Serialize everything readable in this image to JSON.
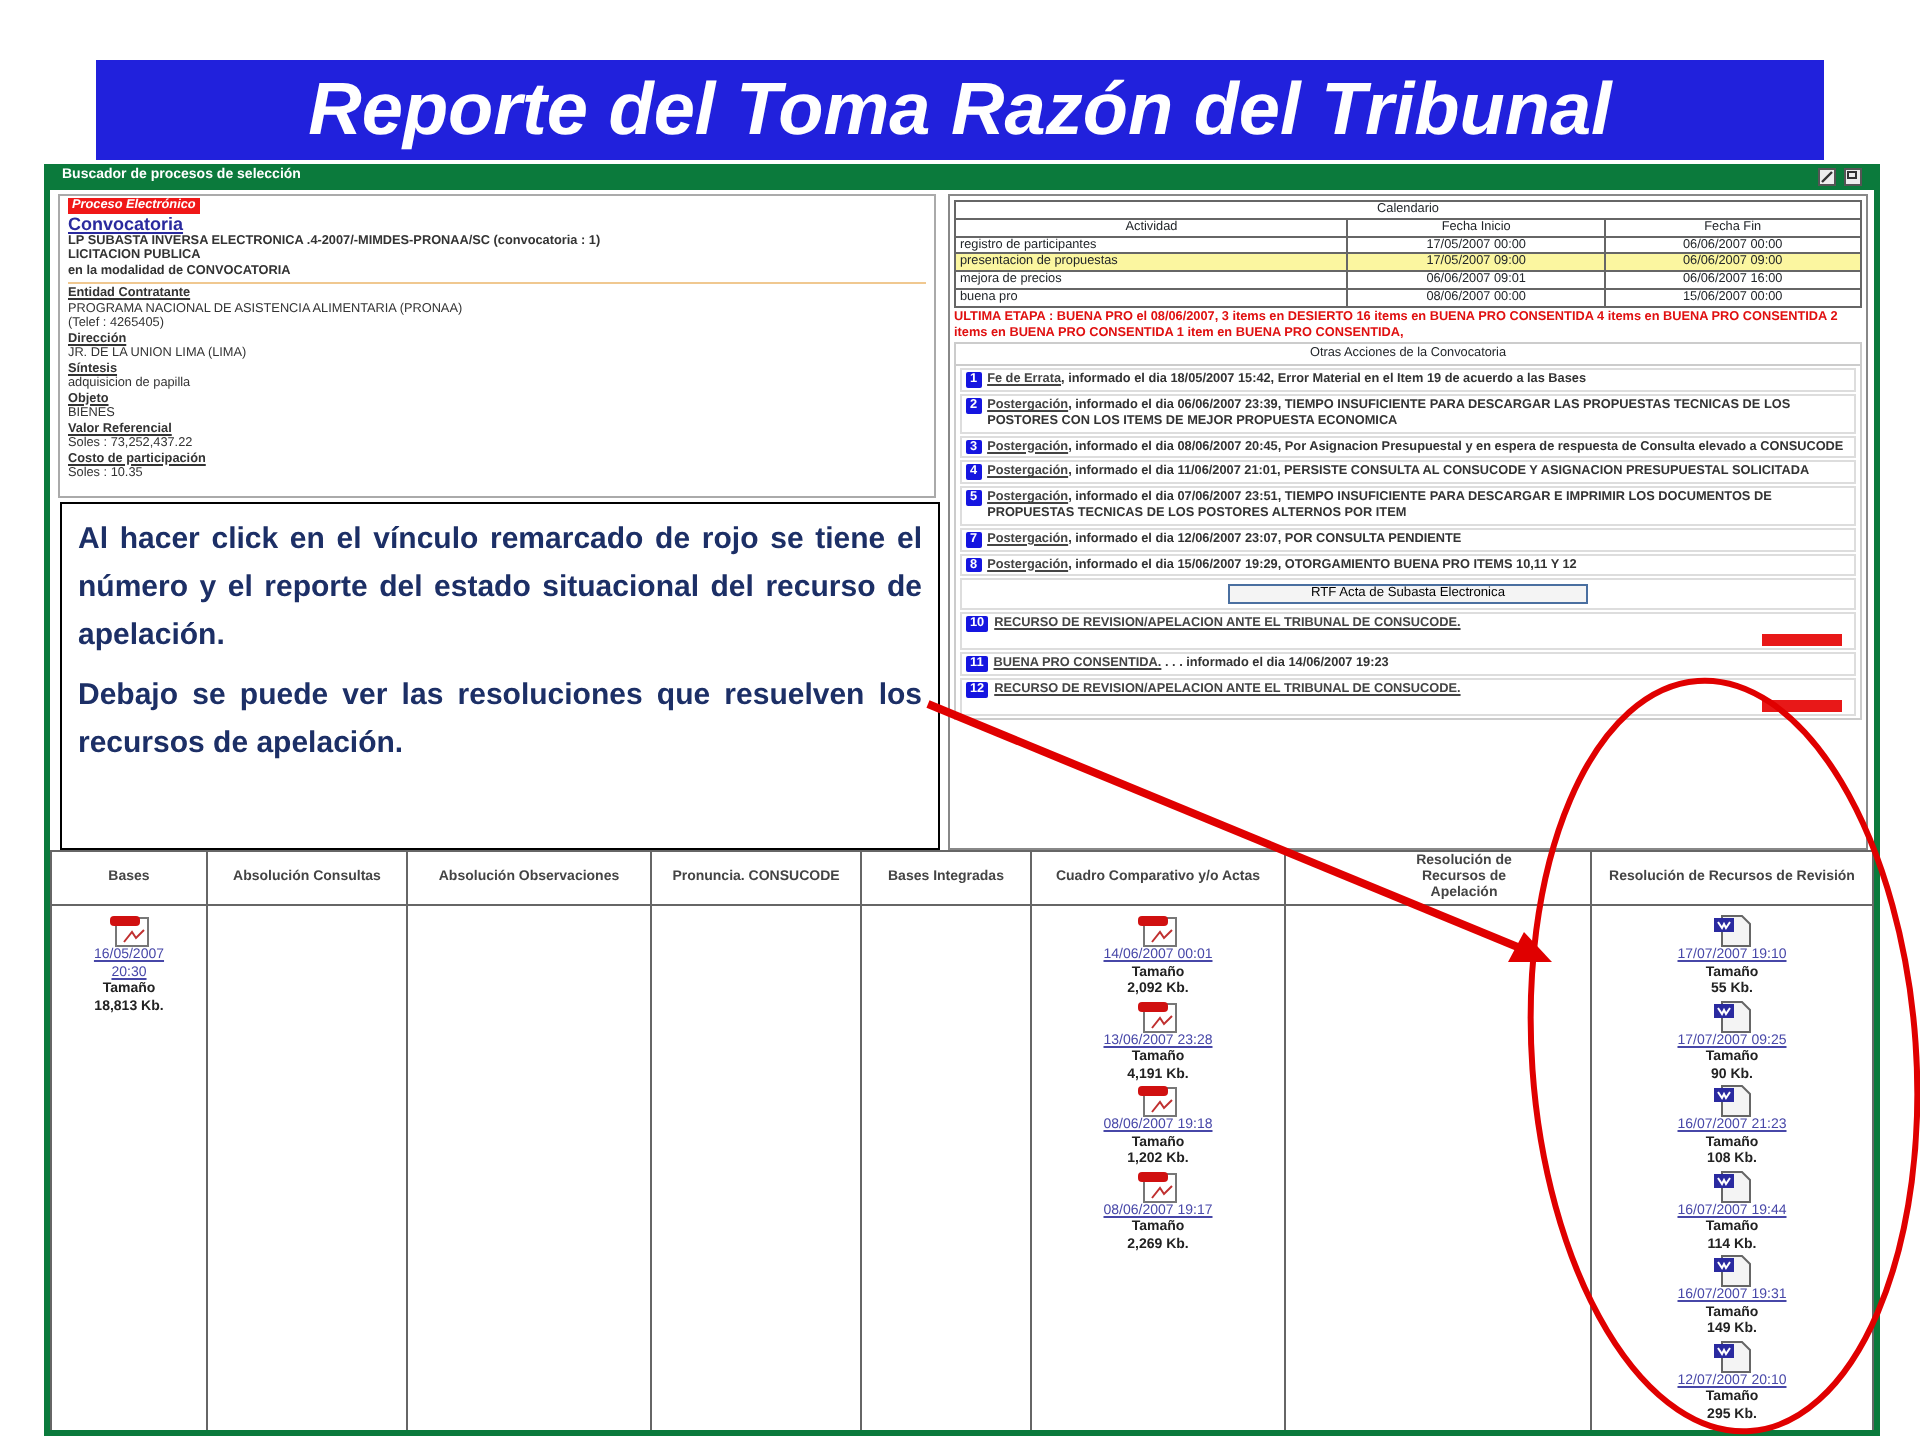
{
  "slide_title": "Reporte del Toma Razón del Tribunal",
  "window": {
    "title": "Buscador de procesos de selección"
  },
  "process": {
    "tag": "Proceso Electrónico",
    "link": "Convocatoria",
    "lines": [
      "LP SUBASTA INVERSA ELECTRONICA .4-2007/-MIMDES-PRONAA/SC (convocatoria : 1)",
      "LICITACION PUBLICA",
      "en la modalidad de CONVOCATORIA"
    ],
    "fields": [
      {
        "label": "Entidad Contratante",
        "values": [
          "PROGRAMA NACIONAL DE ASISTENCIA ALIMENTARIA (PRONAA)",
          "(Telef : 4265405)"
        ]
      },
      {
        "label": "Dirección",
        "values": [
          "JR. DE LA UNION LIMA (LIMA)"
        ]
      },
      {
        "label": "Síntesis",
        "values": [
          "adquisicion de papilla"
        ]
      },
      {
        "label": "Objeto",
        "values": [
          "BIENES"
        ]
      },
      {
        "label": "Valor Referencial",
        "values": [
          "Soles : 73,252,437.22"
        ]
      },
      {
        "label": "Costo de participación",
        "values": [
          "Soles : 10.35"
        ]
      }
    ]
  },
  "calendar": {
    "title": "Calendario",
    "columns": [
      "Actividad",
      "Fecha Inicio",
      "Fecha Fin"
    ],
    "rows": [
      {
        "cells": [
          "registro de participantes",
          "17/05/2007 00:00",
          "06/06/2007 00:00"
        ],
        "highlighted": false
      },
      {
        "cells": [
          "presentacion de propuestas",
          "17/05/2007 09:00",
          "06/06/2007 09:00"
        ],
        "highlighted": true
      },
      {
        "cells": [
          "mejora de precios",
          "06/06/2007 09:01",
          "06/06/2007 16:00"
        ],
        "highlighted": false
      },
      {
        "cells": [
          "buena pro",
          "08/06/2007 00:00",
          "15/06/2007 00:00"
        ],
        "highlighted": false
      }
    ]
  },
  "status_note": "ULTIMA ETAPA : BUENA PRO el 08/06/2007, 3 items en DESIERTO 16 items en BUENA PRO CONSENTIDA 4 items en BUENA PRO CONSENTIDA 2 items en BUENA PRO CONSENTIDA 1 item en BUENA PRO CONSENTIDA,",
  "actions": {
    "title": "Otras Acciones de la Convocatoria",
    "items": [
      {
        "kind": "action",
        "number": "1",
        "link": "Fe de Errata",
        "text": ", informado el dia 18/05/2007 15:42, Error Material en el Item 19 de acuerdo a las Bases",
        "tagged": false
      },
      {
        "kind": "action",
        "number": "2",
        "link": "Postergación",
        "text": ", informado el dia 06/06/2007 23:39, TIEMPO INSUFICIENTE PARA DESCARGAR LAS PROPUESTAS TECNICAS DE LOS POSTORES CON LOS ITEMS DE MEJOR PROPUESTA ECONOMICA",
        "tagged": false
      },
      {
        "kind": "action",
        "number": "3",
        "link": "Postergación",
        "text": ", informado el dia 08/06/2007 20:45, Por Asignacion Presupuestal y en espera de respuesta de Consulta elevado a CONSUCODE",
        "tagged": false
      },
      {
        "kind": "action",
        "number": "4",
        "link": "Postergación",
        "text": ", informado el dia 11/06/2007 21:01, PERSISTE CONSULTA AL CONSUCODE Y ASIGNACION PRESUPUESTAL SOLICITADA",
        "tagged": false
      },
      {
        "kind": "action",
        "number": "5",
        "link": "Postergación",
        "text": ", informado el dia 07/06/2007 23:51, TIEMPO INSUFICIENTE PARA DESCARGAR E IMPRIMIR LOS DOCUMENTOS DE PROPUESTAS TECNICAS DE LOS POSTORES ALTERNOS POR ITEM",
        "tagged": false
      },
      {
        "kind": "action",
        "number": "7",
        "link": "Postergación",
        "text": ", informado el dia 12/06/2007 23:07, POR CONSULTA PENDIENTE",
        "tagged": false
      },
      {
        "kind": "action",
        "number": "8",
        "link": "Postergación",
        "text": ", informado el dia 15/06/2007 19:29, OTORGAMIENTO BUENA PRO ITEMS 10,11 Y 12",
        "tagged": false
      },
      {
        "kind": "button",
        "label": "RTF Acta de Subasta Electronica"
      },
      {
        "kind": "action",
        "number": "10",
        "link": "RECURSO DE REVISION/APELACION ANTE EL TRIBUNAL DE CONSUCODE.",
        "tagged": true
      },
      {
        "kind": "action",
        "number": "11",
        "link": "BUENA PRO CONSENTIDA.",
        "text": " . . . informado el dia 14/06/2007 19:23",
        "tagged": false
      },
      {
        "kind": "action",
        "number": "12",
        "link": "RECURSO DE REVISION/APELACION ANTE EL TRIBUNAL DE CONSUCODE.",
        "tagged": true
      }
    ]
  },
  "callout": {
    "paragraphs": [
      "Al hacer click en  el vínculo remarcado de rojo se tiene el número y el reporte del estado situacional del recurso de apelación.",
      "Debajo se puede ver las resoluciones que resuelven los recursos de apelación."
    ]
  },
  "documents": {
    "columns": [
      {
        "header": "Bases",
        "files": [
          {
            "kind": "pdf",
            "date": "16/05/2007 20:30",
            "size_label": "Tamaño",
            "size": "18,813 Kb."
          }
        ]
      },
      {
        "header": "Absolución Consultas"
      },
      {
        "header": "Absolución Observaciones"
      },
      {
        "header": "Pronuncia. CONSUCODE"
      },
      {
        "header": "Bases Integradas"
      },
      {
        "header": "Cuadro Comparativo y/o Actas",
        "files": [
          {
            "kind": "pdf",
            "date": "14/06/2007 00:01",
            "size_label": "Tamaño",
            "size": "2,092 Kb."
          },
          {
            "kind": "pdf",
            "date": "13/06/2007 23:28",
            "size_label": "Tamaño",
            "size": "4,191 Kb."
          },
          {
            "kind": "pdf",
            "date": "08/06/2007 19:18",
            "size_label": "Tamaño",
            "size": "1,202 Kb."
          },
          {
            "kind": "pdf",
            "date": "08/06/2007 19:17",
            "size_label": "Tamaño",
            "size": "2,269 Kb."
          }
        ]
      },
      {
        "header": "Resolución de Recursos de Apelación"
      },
      {
        "header": "Resolución de Recursos de Revisión",
        "files": [
          {
            "kind": "word",
            "date": "17/07/2007 19:10",
            "size_label": "Tamaño",
            "size": "55 Kb."
          },
          {
            "kind": "word",
            "date": "17/07/2007 09:25",
            "size_label": "Tamaño",
            "size": "90 Kb."
          },
          {
            "kind": "word",
            "date": "16/07/2007 21:23",
            "size_label": "Tamaño",
            "size": "108 Kb."
          },
          {
            "kind": "word",
            "date": "16/07/2007 19:44",
            "size_label": "Tamaño",
            "size": "114 Kb."
          },
          {
            "kind": "word",
            "date": "16/07/2007 19:31",
            "size_label": "Tamaño",
            "size": "149 Kb."
          },
          {
            "kind": "word",
            "date": "12/07/2007 20:10",
            "size_label": "Tamaño",
            "size": "295 Kb."
          }
        ]
      }
    ]
  }
}
